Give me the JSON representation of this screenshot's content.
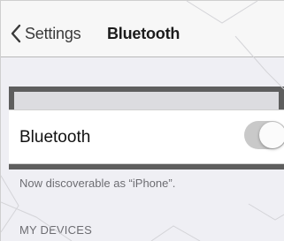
{
  "navbar": {
    "back_label": "Settings",
    "title": "Bluetooth"
  },
  "bluetooth_row": {
    "label": "Bluetooth",
    "toggle_on": true
  },
  "footer": {
    "discoverable_text": "Now discoverable as “iPhone”."
  },
  "devices_section": {
    "header": "MY DEVICES"
  },
  "colors": {
    "highlight_border": "#5e5e5e",
    "toggle_track": "#c9c9c9",
    "background": "#efeff4"
  },
  "icons": {
    "back": "chevron-left-icon"
  }
}
